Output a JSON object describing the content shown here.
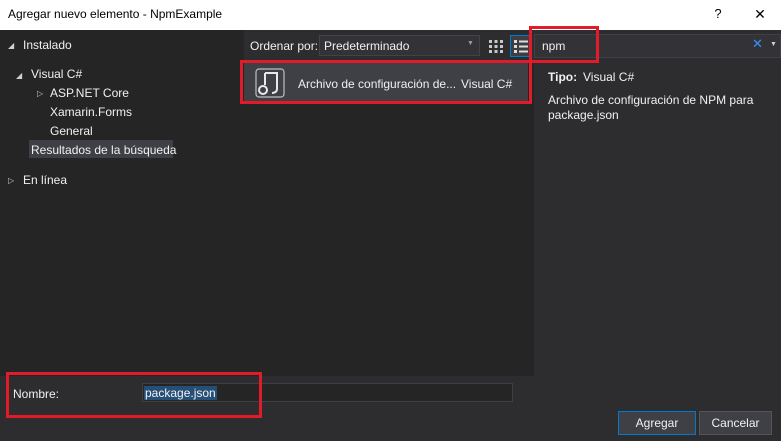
{
  "window": {
    "title": "Agregar nuevo elemento - NpmExample",
    "help": "?",
    "close": "✕"
  },
  "tree": {
    "installed": "Instalado",
    "visual_csharp": "Visual C#",
    "aspnet_core": "ASP.NET Core",
    "xamarin_forms": "Xamarin.Forms",
    "general": "General",
    "search_results": "Resultados de la búsqueda",
    "online": "En línea"
  },
  "toolbar": {
    "sort_label": "Ordenar por:",
    "sort_value": "Predeterminado"
  },
  "search": {
    "value": "npm",
    "clear": "✕"
  },
  "results": [
    {
      "name": "Archivo de configuración de...",
      "language": "Visual C#"
    }
  ],
  "details": {
    "type_label": "Tipo:",
    "type_value": "Visual C#",
    "description": "Archivo de configuración de NPM para package.json"
  },
  "bottom": {
    "name_label": "Nombre:",
    "name_value": "package.json",
    "add_label": "Agregar",
    "cancel_label": "Cancelar"
  },
  "colors": {
    "annotation": "#e21b2b",
    "accent": "#007acc",
    "background": "#2d2d30"
  }
}
